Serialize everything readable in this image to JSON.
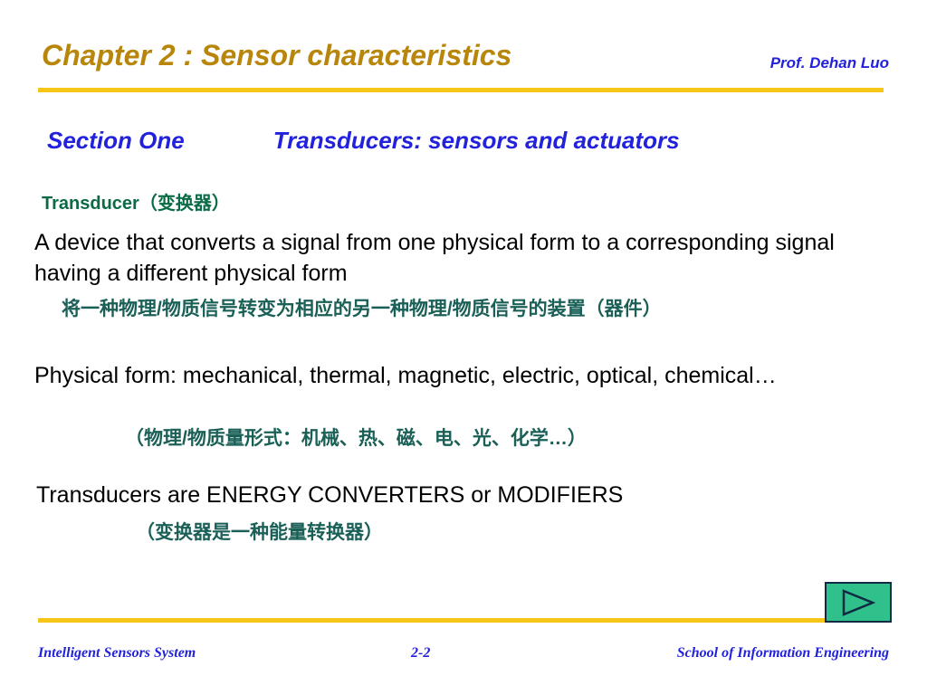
{
  "header": {
    "title": "Chapter 2 : Sensor characteristics",
    "presenter": "Prof. Dehan Luo"
  },
  "section": {
    "label": "Section One",
    "topic": "Transducers: sensors and actuators"
  },
  "content": {
    "term_heading": "Transducer（变换器）",
    "definition_en": " A device that converts a signal from one physical form to a corresponding signal having a different physical form",
    "definition_cn": "将一种物理/物质信号转变为相应的另一种物理/物质信号的装置（器件）",
    "forms_en": " Physical form: mechanical, thermal, magnetic, electric, optical, chemical…",
    "forms_cn": "（物理/物质量形式：机械、热、磁、电、光、化学…）",
    "energy_en": "Transducers are ENERGY CONVERTERS or MODIFIERS",
    "energy_cn": "（变换器是一种能量转换器）"
  },
  "footer": {
    "left": "Intelligent Sensors System",
    "page": "2-2",
    "right": "School of Information Engineering"
  },
  "nav": {
    "next_icon": "play-triangle-icon"
  },
  "colors": {
    "title_gold": "#b8860b",
    "rule_gold": "#f5c518",
    "heading_blue": "#2222dd",
    "term_green": "#0a6b45",
    "chinese_teal": "#1a6057",
    "button_fill": "#2fc08c",
    "button_border": "#102a43",
    "body_black": "#000000"
  }
}
